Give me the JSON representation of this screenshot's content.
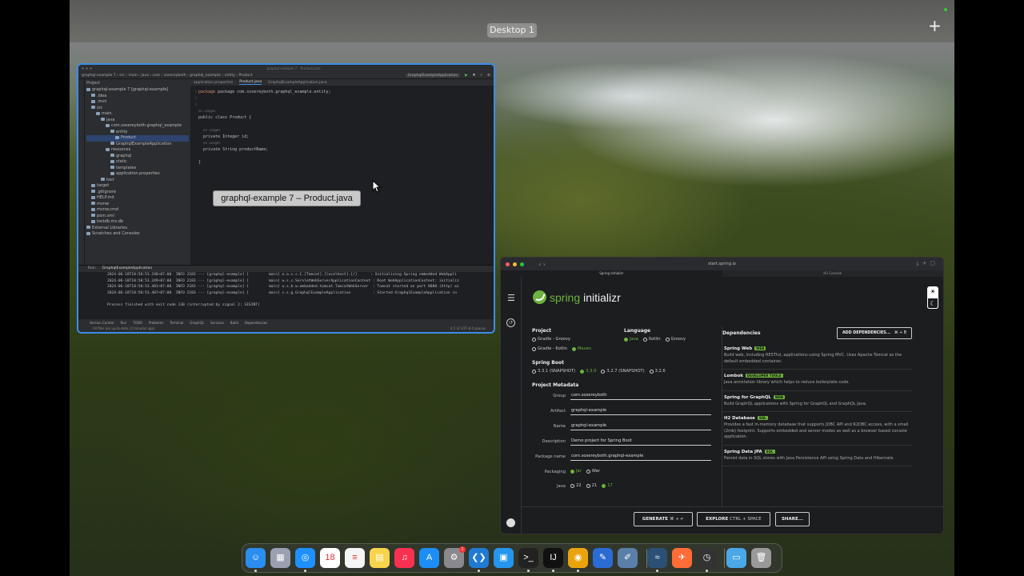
{
  "desktop": {
    "label": "Desktop 1",
    "add_symbol": "+"
  },
  "ide": {
    "window_title": "graphql-example 7 – Product.java",
    "breadcrumb": [
      "graphql-example 7",
      "src",
      "main",
      "java",
      "com",
      "sosereyboth",
      "graphql_example",
      "entity",
      "Product"
    ],
    "run_config": "GraphqlExampleApplication",
    "project_header": "Project",
    "tree": [
      "graphql-example 7 [graphql-example]",
      ".idea",
      ".mvn",
      "src",
      "main",
      "java",
      "com.sosereyboth.graphql_example",
      "entity",
      "Product",
      "GraphqlExampleApplication",
      "resources",
      "graphql",
      "static",
      "templates",
      "application.properties",
      "test",
      "target",
      ".gitignore",
      "HELP.md",
      "mvnw",
      "mvnw.cmd",
      "pom.xml",
      "testdb.mv.db",
      "External Libraries",
      "Scratches and Consoles"
    ],
    "tabs": [
      "application.properties",
      "Product.java",
      "GraphqlExampleApplication.java"
    ],
    "gutter": [
      "1",
      "2",
      "3",
      "",
      "",
      "",
      "",
      "",
      "",
      "",
      "",
      "",
      ""
    ],
    "code": {
      "line1": "package com.sosereyboth.graphql_example.entity;",
      "usages1": "no usages",
      "line2": "public class Product {",
      "usages2": "no usages",
      "line3": "private Integer id;",
      "usages3": "no usages",
      "line4": "private String productName;",
      "line5": "}"
    },
    "tooltip": "graphql-example 7 – Product.java",
    "run": {
      "label": "Run:",
      "tab": "GraphqlExampleApplication",
      "logs": [
        "2024-06-18T18:58:53.248+07:00  INFO 2183 --- [graphql-example] [         main] o.a.c.c.C.[Tomcat].[localhost].[/]      : Initializing Spring embedded WebAppli",
        "2024-06-18T18:58:53.249+07:00  INFO 2183 --- [graphql-example] [         main] w.s.c.ServletWebServerApplicationContext : Root WebApplicationContext: initializ",
        "2024-06-18T18:58:53.481+07:00  INFO 2183 --- [graphql-example] [         main] o.s.b.w.embedded.tomcat.TomcatWebServer  : Tomcat started on port 8080 (http) wi",
        "2024-06-18T18:58:53.487+07:00  INFO 2183 --- [graphql-example] [         main] c.s.g.GraphqlExampleApplication          : Started GraphqlExampleApplication in",
        "",
        "Process finished with exit code 130 (interrupted by signal 2: SIGINT)"
      ]
    },
    "bottom_tabs": [
      "Version Control",
      "Run",
      "TODO",
      "Problems",
      "Terminal",
      "GraphQL",
      "Services",
      "Build",
      "Dependencies"
    ],
    "status_left": "All files are up-to-date (2 minutes ago)",
    "status_right": "4:1  LF  UTF-8  4 spaces"
  },
  "browser": {
    "url": "start.spring.io",
    "tabs": [
      "Spring Initializr",
      "H2 Console"
    ],
    "logo_spring": "spring",
    "logo_initializr": "initializr",
    "project": {
      "title": "Project",
      "options": [
        {
          "label": "Gradle - Groovy",
          "selected": false
        },
        {
          "label": "Gradle - Kotlin",
          "selected": false
        },
        {
          "label": "Maven",
          "selected": true
        }
      ]
    },
    "language": {
      "title": "Language",
      "options": [
        {
          "label": "Java",
          "selected": true
        },
        {
          "label": "Kotlin",
          "selected": false
        },
        {
          "label": "Groovy",
          "selected": false
        }
      ]
    },
    "spring_boot": {
      "title": "Spring Boot",
      "options": [
        {
          "label": "3.3.1 (SNAPSHOT)",
          "selected": false
        },
        {
          "label": "3.3.0",
          "selected": true
        },
        {
          "label": "3.2.7 (SNAPSHOT)",
          "selected": false
        },
        {
          "label": "3.2.6",
          "selected": false
        }
      ]
    },
    "metadata": {
      "title": "Project Metadata",
      "fields": [
        {
          "label": "Group",
          "value": "com.sosereyboth"
        },
        {
          "label": "Artifact",
          "value": "graphql-example"
        },
        {
          "label": "Name",
          "value": "graphql-example"
        },
        {
          "label": "Description",
          "value": "Demo project for Spring Boot"
        },
        {
          "label": "Package name",
          "value": "com.sosereyboth.graphql-example"
        }
      ],
      "packaging_label": "Packaging",
      "packaging": [
        {
          "label": "Jar",
          "selected": true
        },
        {
          "label": "War",
          "selected": false
        }
      ],
      "java_label": "Java",
      "java": [
        {
          "label": "22",
          "selected": false
        },
        {
          "label": "21",
          "selected": false
        },
        {
          "label": "17",
          "selected": true
        }
      ]
    },
    "dependencies": {
      "title": "Dependencies",
      "add_button": "ADD DEPENDENCIES...",
      "add_shortcut": "⌘ + B",
      "items": [
        {
          "name": "Spring Web",
          "badge": "WEB",
          "desc": "Build web, including RESTful, applications using Spring MVC. Uses Apache Tomcat as the default embedded container."
        },
        {
          "name": "Lombok",
          "badge": "DEVELOPER TOOLS",
          "desc": "Java annotation library which helps to reduce boilerplate code."
        },
        {
          "name": "Spring for GraphQL",
          "badge": "WEB",
          "desc": "Build GraphQL applications with Spring for GraphQL and GraphQL Java."
        },
        {
          "name": "H2 Database",
          "badge": "SQL",
          "desc": "Provides a fast in-memory database that supports JDBC API and R2DBC access, with a small (2mb) footprint. Supports embedded and server modes as well as a browser based console application."
        },
        {
          "name": "Spring Data JPA",
          "badge": "SQL",
          "desc": "Persist data in SQL stores with Java Persistence API using Spring Data and Hibernate."
        }
      ]
    },
    "footer": {
      "generate": "GENERATE",
      "generate_key": "⌘ + ↵",
      "explore": "EXPLORE",
      "explore_key": "CTRL + SPACE",
      "share": "SHARE..."
    }
  },
  "dock": {
    "apps": [
      {
        "name": "finder-icon",
        "color": "#2a8df0",
        "glyph": "☺"
      },
      {
        "name": "launchpad-icon",
        "color": "#9aa0b0",
        "glyph": "▦"
      },
      {
        "name": "safari-icon",
        "color": "#1e90ff",
        "glyph": "◎"
      },
      {
        "name": "calendar-icon",
        "color": "#ffffff",
        "glyph": "18"
      },
      {
        "name": "reminders-icon",
        "color": "#f5f5f5",
        "glyph": "≡"
      },
      {
        "name": "notes-icon",
        "color": "#f8d44c",
        "glyph": "▤"
      },
      {
        "name": "music-icon",
        "color": "#fa3050",
        "glyph": "♫"
      },
      {
        "name": "app-store-icon",
        "color": "#1c8ef5",
        "glyph": "A"
      },
      {
        "name": "system-settings-icon",
        "color": "#8a8a8e",
        "glyph": "⚙"
      },
      {
        "name": "vscode-icon",
        "color": "#1f7ad4",
        "glyph": "❮❯"
      },
      {
        "name": "docker-icon",
        "color": "#2496ed",
        "glyph": "▣"
      },
      {
        "name": "terminal-icon",
        "color": "#222222",
        "glyph": ">_"
      },
      {
        "name": "intellij-icon",
        "color": "#111111",
        "glyph": "IJ"
      },
      {
        "name": "chrome-icon",
        "color": "#e9a30c",
        "glyph": "◉"
      },
      {
        "name": "xcode-icon",
        "color": "#2a6bd4",
        "glyph": "✎"
      },
      {
        "name": "script-editor-icon",
        "color": "#5a7fa8",
        "glyph": "✐"
      },
      {
        "name": "mysql-workbench-icon",
        "color": "#2b4f75",
        "glyph": "≈"
      },
      {
        "name": "postman-icon",
        "color": "#ff6c37",
        "glyph": "✈"
      },
      {
        "name": "activity-monitor-icon",
        "color": "#333333",
        "glyph": "◷"
      },
      {
        "name": "downloads-folder-icon",
        "color": "#4aa8e8",
        "glyph": "▭"
      },
      {
        "name": "trash-icon",
        "color": "#9a9a9a",
        "glyph": "🗑"
      }
    ],
    "notification_count": "1"
  }
}
